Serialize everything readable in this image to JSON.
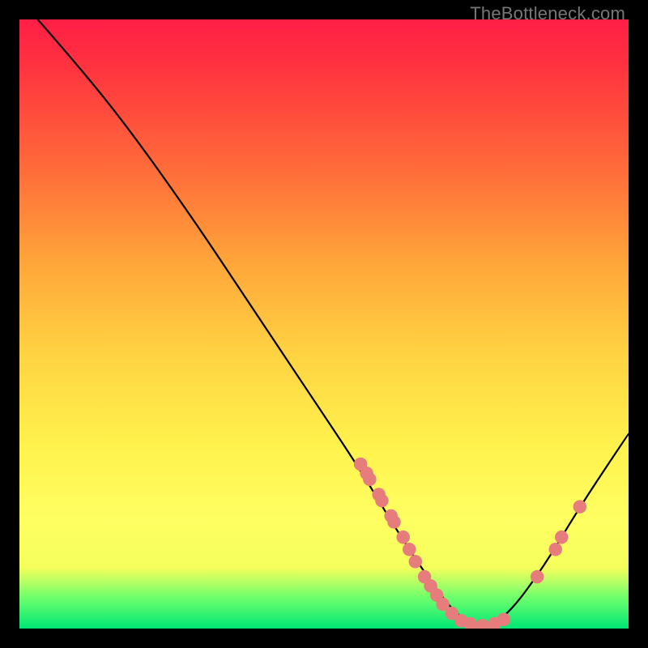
{
  "watermark": "TheBottleneck.com",
  "chart_data": {
    "type": "line",
    "title": "",
    "xlabel": "",
    "ylabel": "",
    "xlim": [
      0,
      100
    ],
    "ylim": [
      0,
      100
    ],
    "series": [
      {
        "name": "curve",
        "points": [
          {
            "x": 3,
            "y": 100
          },
          {
            "x": 10,
            "y": 92
          },
          {
            "x": 18,
            "y": 82
          },
          {
            "x": 28,
            "y": 68
          },
          {
            "x": 38,
            "y": 53
          },
          {
            "x": 48,
            "y": 38
          },
          {
            "x": 56,
            "y": 26
          },
          {
            "x": 62,
            "y": 16
          },
          {
            "x": 68,
            "y": 7
          },
          {
            "x": 72,
            "y": 2
          },
          {
            "x": 76,
            "y": 0
          },
          {
            "x": 80,
            "y": 2
          },
          {
            "x": 86,
            "y": 10
          },
          {
            "x": 92,
            "y": 20
          },
          {
            "x": 100,
            "y": 32
          }
        ]
      }
    ],
    "markers": [
      {
        "x": 56.0,
        "y": 27.0
      },
      {
        "x": 57.0,
        "y": 25.5
      },
      {
        "x": 57.5,
        "y": 24.5
      },
      {
        "x": 59.0,
        "y": 22.0
      },
      {
        "x": 59.5,
        "y": 21.0
      },
      {
        "x": 61.0,
        "y": 18.5
      },
      {
        "x": 61.5,
        "y": 17.5
      },
      {
        "x": 63.0,
        "y": 15.0
      },
      {
        "x": 64.0,
        "y": 13.0
      },
      {
        "x": 65.0,
        "y": 11.0
      },
      {
        "x": 66.5,
        "y": 8.5
      },
      {
        "x": 67.5,
        "y": 7.0
      },
      {
        "x": 68.5,
        "y": 5.5
      },
      {
        "x": 69.5,
        "y": 4.0
      },
      {
        "x": 71.0,
        "y": 2.5
      },
      {
        "x": 72.5,
        "y": 1.3
      },
      {
        "x": 74.0,
        "y": 0.8
      },
      {
        "x": 76.0,
        "y": 0.5
      },
      {
        "x": 78.0,
        "y": 0.8
      },
      {
        "x": 79.5,
        "y": 1.5
      },
      {
        "x": 85.0,
        "y": 8.5
      },
      {
        "x": 88.0,
        "y": 13.0
      },
      {
        "x": 89.0,
        "y": 15.0
      },
      {
        "x": 92.0,
        "y": 20.0
      }
    ],
    "marker_color": "#e77c7c",
    "marker_radius": 1.1,
    "line_color": "#000000"
  }
}
